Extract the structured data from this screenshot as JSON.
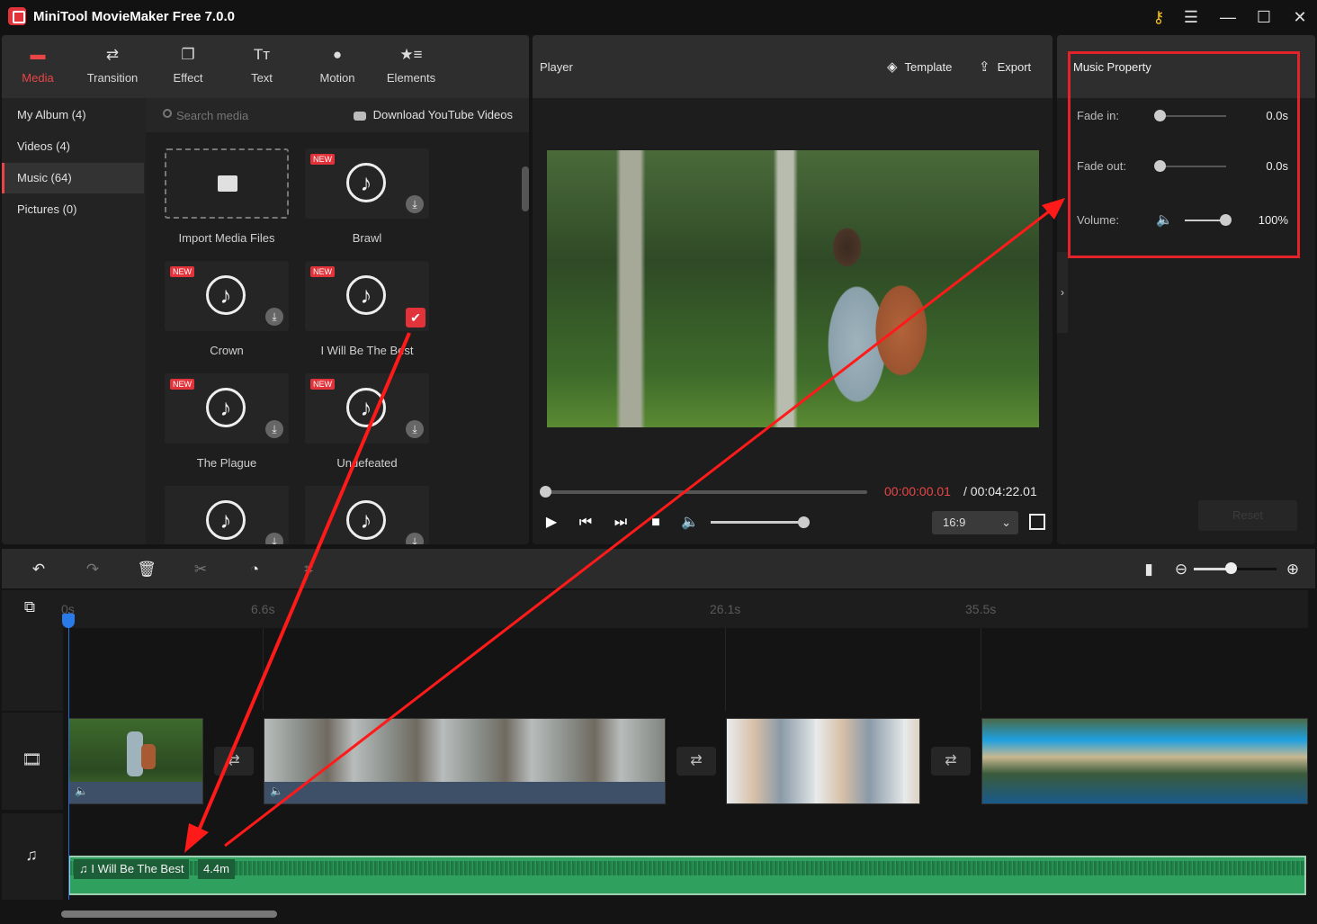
{
  "app": {
    "title": "MiniTool MovieMaker Free 7.0.0",
    "window_controls": [
      "key-icon",
      "menu-icon",
      "minimize-icon",
      "maximize-icon",
      "close-icon"
    ]
  },
  "tabs": [
    {
      "label": "Media",
      "icon": "media-folder-icon",
      "active": true
    },
    {
      "label": "Transition",
      "icon": "transition-icon",
      "active": false
    },
    {
      "label": "Effect",
      "icon": "effect-icon",
      "active": false
    },
    {
      "label": "Text",
      "icon": "text-icon",
      "active": false
    },
    {
      "label": "Motion",
      "icon": "motion-icon",
      "active": false
    },
    {
      "label": "Elements",
      "icon": "elements-icon",
      "active": false
    }
  ],
  "categories": [
    {
      "label": "My Album (4)",
      "active": false
    },
    {
      "label": "Videos (4)",
      "active": false
    },
    {
      "label": "Music (64)",
      "active": true
    },
    {
      "label": "Pictures (0)",
      "active": false
    }
  ],
  "search": {
    "placeholder": "Search media",
    "youtube_link": "Download YouTube Videos"
  },
  "media_items": [
    {
      "label": "Import Media Files",
      "type": "import"
    },
    {
      "label": "Brawl",
      "new": true,
      "state": "download"
    },
    {
      "label": "Crown",
      "new": true,
      "state": "download"
    },
    {
      "label": "I Will Be The Best",
      "new": true,
      "state": "added"
    },
    {
      "label": "The Plague",
      "new": true,
      "state": "download"
    },
    {
      "label": "Undefeated",
      "new": true,
      "state": "download"
    },
    {
      "label": "",
      "new": false,
      "state": "download"
    },
    {
      "label": "",
      "new": false,
      "state": "download"
    }
  ],
  "player": {
    "title": "Player",
    "template_label": "Template",
    "export_label": "Export",
    "current_time": "00:00:00.01",
    "total_time": "/ 00:04:22.01",
    "progress": 0.0,
    "volume": 1.0,
    "aspect_ratio": "16:9"
  },
  "music_property": {
    "title": "Music Property",
    "fade_in": {
      "label": "Fade in:",
      "value": "0.0s",
      "level": 0.0
    },
    "fade_out": {
      "label": "Fade out:",
      "value": "0.0s",
      "level": 0.0
    },
    "volume": {
      "label": "Volume:",
      "value": "100%",
      "level": 1.0
    },
    "reset_label": "Reset"
  },
  "timeline": {
    "zoom_level": 0.45,
    "ruler_ticks": [
      "0s",
      "6.6s",
      "26.1s",
      "35.5s"
    ],
    "video_clips": [
      {
        "name": "forest-hiker-clip",
        "has_audio": true
      },
      {
        "name": "hot-air-balloons-clip",
        "has_audio": true
      },
      {
        "name": "couple-selfie-clip",
        "has_audio": false
      },
      {
        "name": "coastal-cliffs-clip",
        "has_audio": false
      }
    ],
    "music_clip": {
      "title": "I Will Be The Best",
      "duration": "4.4m"
    }
  },
  "colors": {
    "accent": "#e84646",
    "highlight_box": "#e2232a",
    "music_clip": "#2fa05d",
    "playhead": "#2a7be8"
  }
}
